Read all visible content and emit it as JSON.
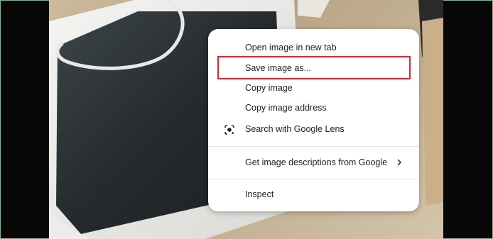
{
  "menu": {
    "items": [
      {
        "label": "Open image in new tab"
      },
      {
        "label": "Save image as..."
      },
      {
        "label": "Copy image"
      },
      {
        "label": "Copy image address"
      },
      {
        "label": "Search with Google Lens",
        "icon": "google-lens-icon"
      },
      {
        "label": "Get image descriptions from Google",
        "icon": "chevron-right-icon"
      },
      {
        "label": "Inspect"
      }
    ]
  },
  "highlight_color": "#cf2a36"
}
